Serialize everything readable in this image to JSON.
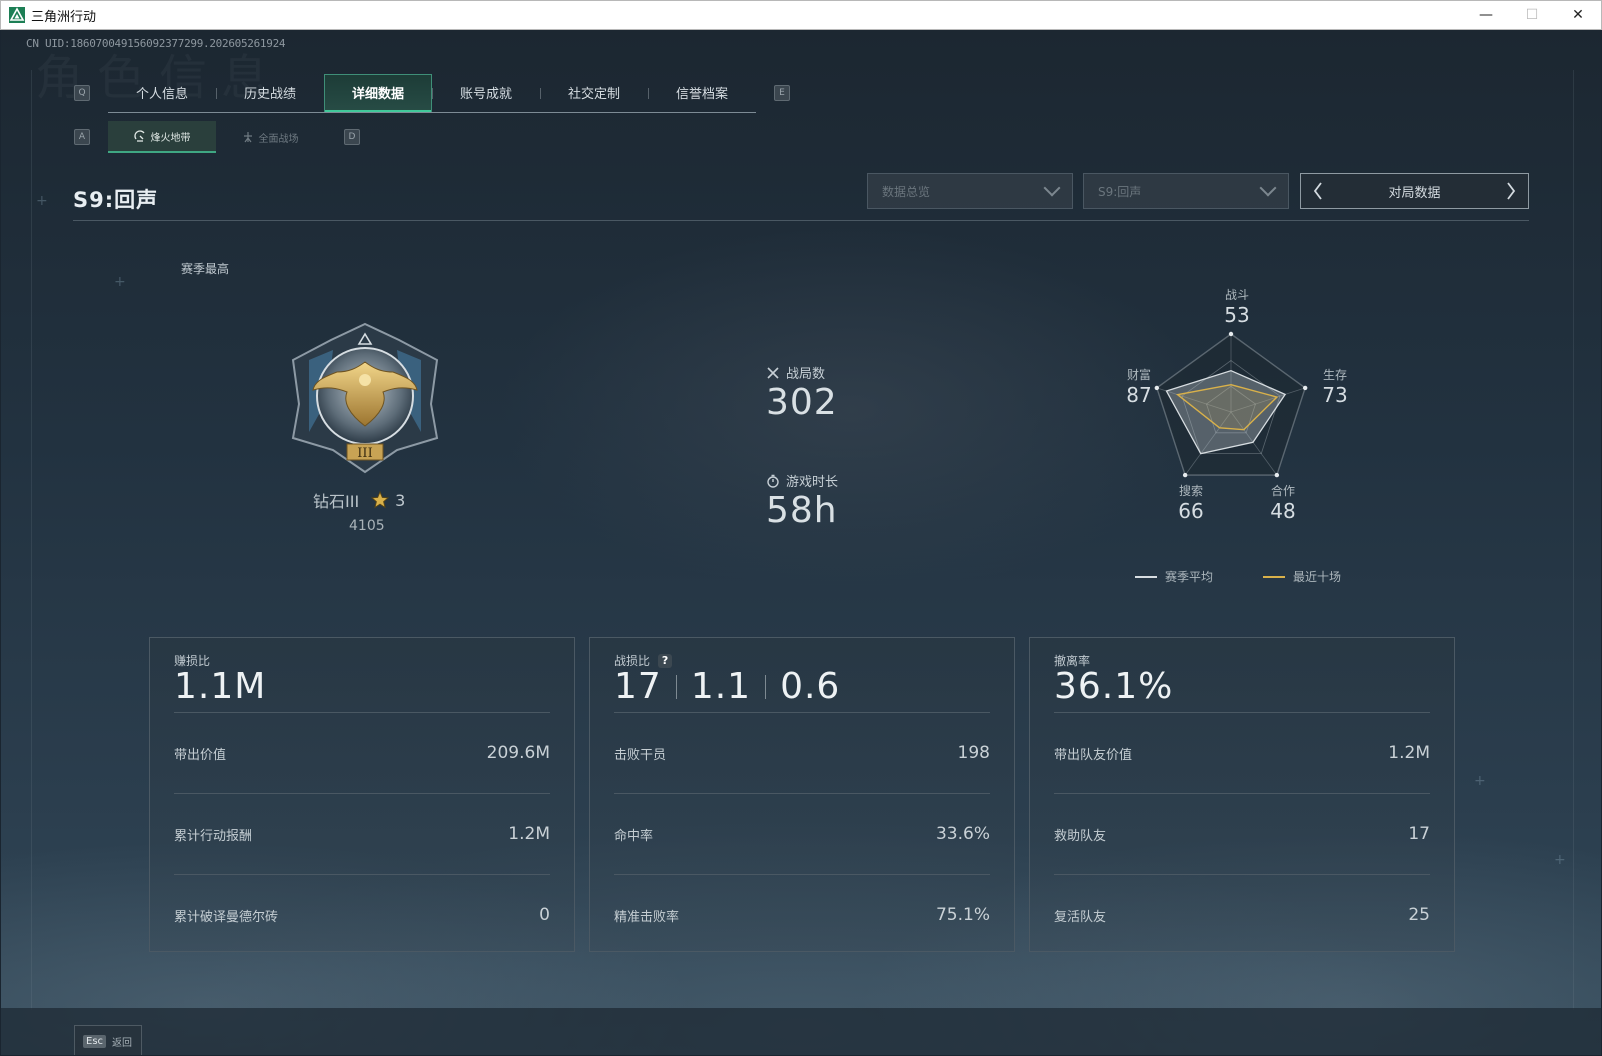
{
  "window": {
    "title": "三角洲行动",
    "minimize_label": "—",
    "maximize_label": "☐",
    "close_label": "✕"
  },
  "uid": "CN UID:186070049156092377299.202605261924",
  "watermark": "角色信息",
  "tabs": {
    "left_key": "Q",
    "right_key": "E",
    "items": [
      {
        "label": "个人信息"
      },
      {
        "label": "历史战绩"
      },
      {
        "label": "详细数据",
        "active": true
      },
      {
        "label": "账号成就"
      },
      {
        "label": "社交定制"
      },
      {
        "label": "信誉档案"
      }
    ]
  },
  "subtabs": {
    "left_key": "A",
    "right_key": "D",
    "items": [
      {
        "label": "烽火地带",
        "active": true,
        "icon": "radar-dish-icon"
      },
      {
        "label": "全面战场",
        "active": false,
        "icon": "soldier-icon"
      }
    ]
  },
  "header": {
    "season_title": "S9:回声",
    "select_overview": "数据总览",
    "select_season": "S9:回声",
    "pager_label": "对局数据"
  },
  "rank": {
    "season_best_label": "赛季最高",
    "name": "钻石III",
    "stars": "3",
    "score": "4105",
    "emblem_numeral": "III"
  },
  "stats": {
    "matches_label": "战局数",
    "matches_value": "302",
    "playtime_label": "游戏时长",
    "playtime_value": "58h"
  },
  "radar": {
    "labels": [
      {
        "name": "战斗",
        "value": "53"
      },
      {
        "name": "生存",
        "value": "73"
      },
      {
        "name": "合作",
        "value": "48"
      },
      {
        "name": "搜索",
        "value": "66"
      },
      {
        "name": "财富",
        "value": "87"
      }
    ],
    "season_avg": [
      0.53,
      0.73,
      0.48,
      0.66,
      0.87
    ],
    "recent_ten": [
      0.35,
      0.62,
      0.28,
      0.25,
      0.72
    ],
    "legend_avg": "赛季平均",
    "legend_recent": "最近十场",
    "color_avg": "#d7dde1",
    "color_recent": "#d9b14a"
  },
  "cards": [
    {
      "title": "赚损比",
      "big": [
        "1.1M"
      ],
      "rows": [
        {
          "k": "带出价值",
          "v": "209.6M"
        },
        {
          "k": "累计行动报酬",
          "v": "1.2M"
        },
        {
          "k": "累计破译曼德尔砖",
          "v": "0"
        }
      ]
    },
    {
      "title": "战损比",
      "help": "?",
      "big": [
        "17",
        "1.1",
        "0.6"
      ],
      "rows": [
        {
          "k": "击败干员",
          "v": "198"
        },
        {
          "k": "命中率",
          "v": "33.6%"
        },
        {
          "k": "精准击败率",
          "v": "75.1%"
        }
      ]
    },
    {
      "title": "撤离率",
      "big": [
        "36.1%"
      ],
      "rows": [
        {
          "k": "带出队友价值",
          "v": "1.2M"
        },
        {
          "k": "救助队友",
          "v": "17"
        },
        {
          "k": "复活队友",
          "v": "25"
        }
      ]
    }
  ],
  "footer": {
    "esc_key": "Esc",
    "back_label": "返回"
  }
}
